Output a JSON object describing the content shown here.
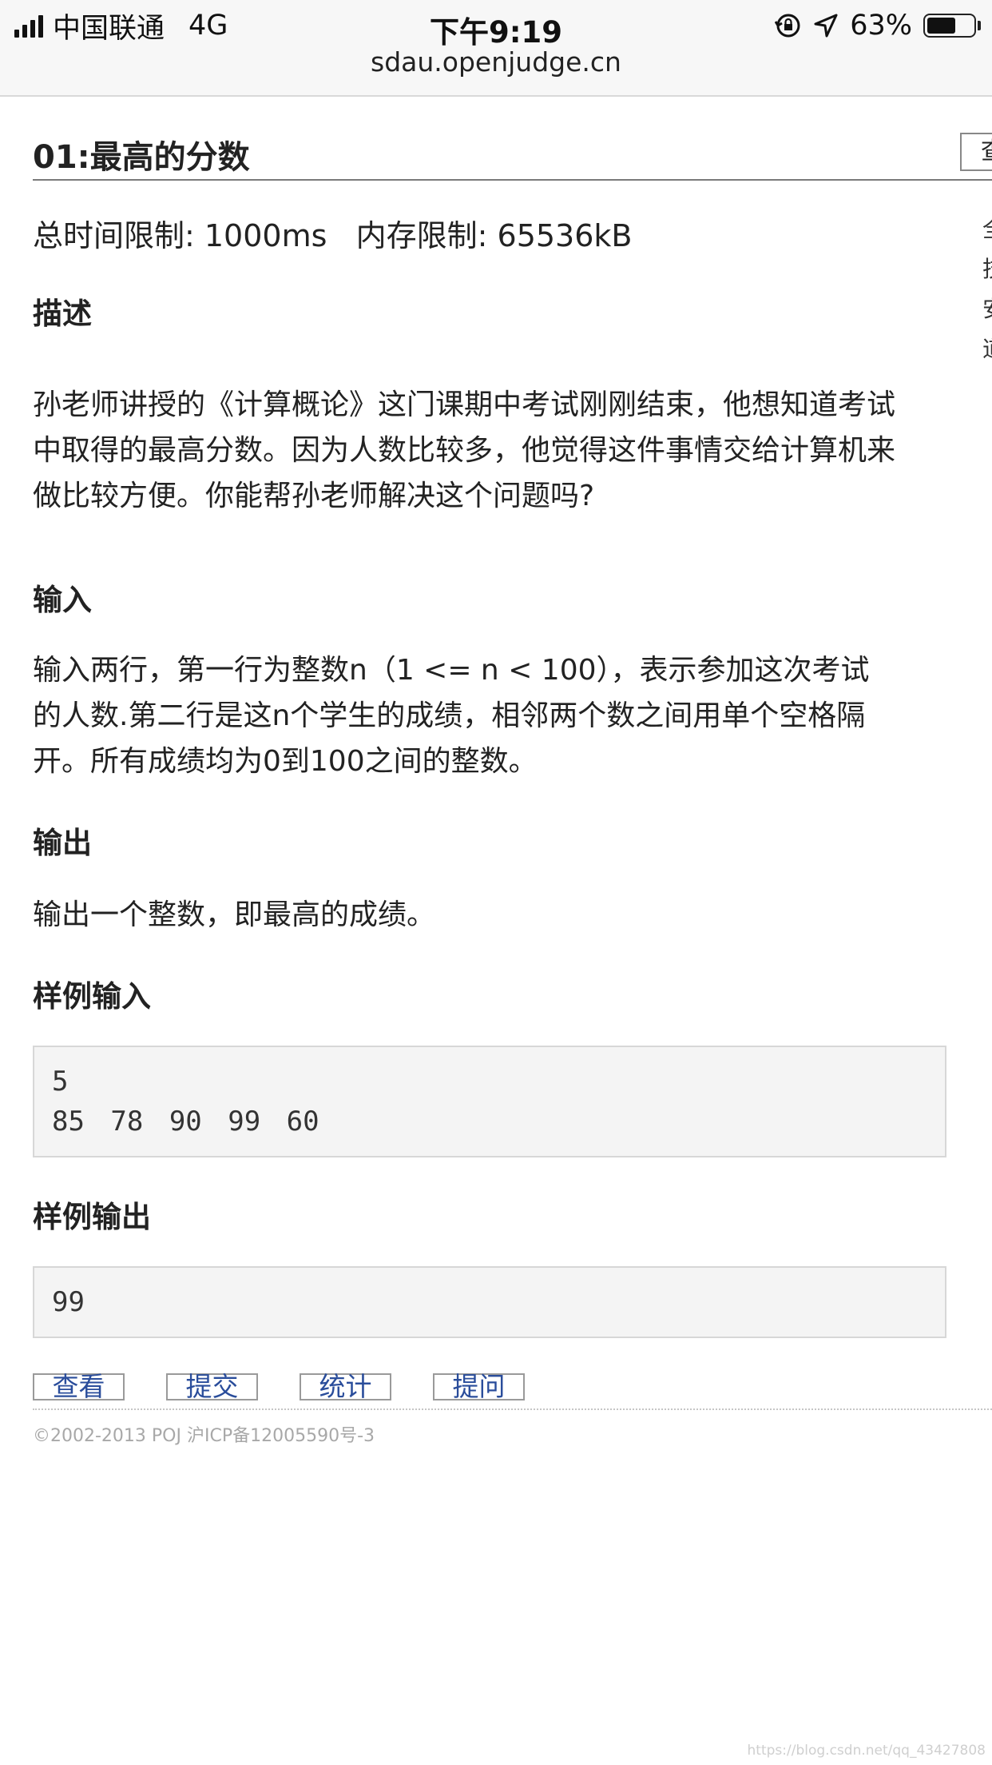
{
  "status_bar": {
    "carrier": "中国联通",
    "network": "4G",
    "time": "下午9:19",
    "battery_percent": "63%",
    "battery_level": 0.63
  },
  "browser": {
    "url": "sdau.openjudge.cn"
  },
  "problem": {
    "title": "01:最高的分数",
    "limits": "总时间限制: 1000ms   内存限制: 65536kB",
    "description_heading": "描述",
    "description_lines": [
      "孙老师讲授的《计算概论》这门课期中考试刚刚结束，他想知道考试",
      "中取得的最高分数。因为人数比较多，他觉得这件事情交给计算机来",
      "做比较方便。你能帮孙老师解决这个问题吗?"
    ],
    "input_heading": "输入",
    "input_lines": [
      "输入两行，第一行为整数n（1 <= n < 100），表示参加这次考试",
      "的人数.第二行是这n个学生的成绩，相邻两个数之间用单个空格隔",
      "开。所有成绩均为0到100之间的整数。"
    ],
    "output_heading": "输出",
    "output_text": "输出一个整数，即最高的成绩。",
    "sample_input_heading": "样例输入",
    "sample_input_lines": [
      "5",
      "85 78 90 99 60"
    ],
    "sample_output_heading": "样例输出",
    "sample_output_lines": [
      "99"
    ]
  },
  "side_panel": {
    "tab_label": "查",
    "links": [
      "全",
      "技",
      "安",
      "道"
    ]
  },
  "bottom_links": {
    "view": "查看",
    "submit": "提交",
    "stats": "统计",
    "ask": "提问"
  },
  "footer": {
    "copyright": "©2002-2013 POJ 沪ICP备12005590号-3",
    "watermark": "https://blog.csdn.net/qq_43427808"
  }
}
